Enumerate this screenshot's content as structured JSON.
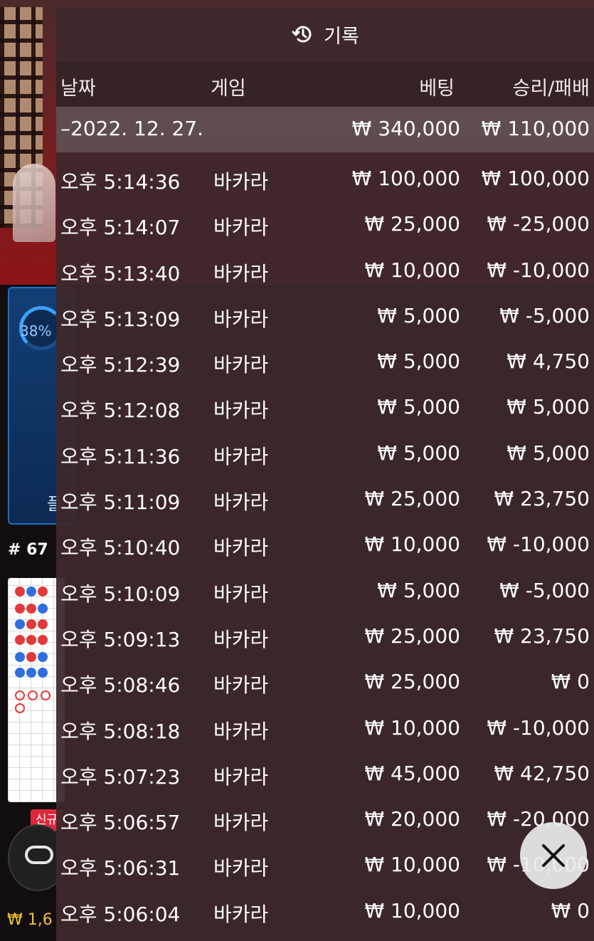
{
  "panel": {
    "title": "기록",
    "header_icon": "history-icon",
    "columns": {
      "date": "날짜",
      "game": "게임",
      "bet": "베팅",
      "win_loss": "승리/패배"
    },
    "summary": {
      "date": "–2022. 12. 27.",
      "bet": "₩ 340,000",
      "win_loss": "₩ 110,000"
    },
    "rows": [
      {
        "time": "오후 5:14:36",
        "game": "바카라",
        "bet": "₩ 100,000",
        "win_loss": "₩ 100,000"
      },
      {
        "time": "오후 5:14:07",
        "game": "바카라",
        "bet": "₩ 25,000",
        "win_loss": "₩ -25,000"
      },
      {
        "time": "오후 5:13:40",
        "game": "바카라",
        "bet": "₩ 10,000",
        "win_loss": "₩ -10,000"
      },
      {
        "time": "오후 5:13:09",
        "game": "바카라",
        "bet": "₩ 5,000",
        "win_loss": "₩ -5,000"
      },
      {
        "time": "오후 5:12:39",
        "game": "바카라",
        "bet": "₩ 5,000",
        "win_loss": "₩ 4,750"
      },
      {
        "time": "오후 5:12:08",
        "game": "바카라",
        "bet": "₩ 5,000",
        "win_loss": "₩ 5,000"
      },
      {
        "time": "오후 5:11:36",
        "game": "바카라",
        "bet": "₩ 5,000",
        "win_loss": "₩ 5,000"
      },
      {
        "time": "오후 5:11:09",
        "game": "바카라",
        "bet": "₩ 25,000",
        "win_loss": "₩ 23,750"
      },
      {
        "time": "오후 5:10:40",
        "game": "바카라",
        "bet": "₩ 10,000",
        "win_loss": "₩ -10,000"
      },
      {
        "time": "오후 5:10:09",
        "game": "바카라",
        "bet": "₩ 5,000",
        "win_loss": "₩ -5,000"
      },
      {
        "time": "오후 5:09:13",
        "game": "바카라",
        "bet": "₩ 25,000",
        "win_loss": "₩ 23,750"
      },
      {
        "time": "오후 5:08:46",
        "game": "바카라",
        "bet": "₩ 25,000",
        "win_loss": "₩ 0"
      },
      {
        "time": "오후 5:08:18",
        "game": "바카라",
        "bet": "₩ 10,000",
        "win_loss": "₩ -10,000"
      },
      {
        "time": "오후 5:07:23",
        "game": "바카라",
        "bet": "₩ 45,000",
        "win_loss": "₩ 42,750"
      },
      {
        "time": "오후 5:06:57",
        "game": "바카라",
        "bet": "₩ 20,000",
        "win_loss": "₩ -20,000"
      },
      {
        "time": "오후 5:06:31",
        "game": "바카라",
        "bet": "₩ 10,000",
        "win_loss": "₩ -10,000"
      },
      {
        "time": "오후 5:06:04",
        "game": "바카라",
        "bet": "₩ 10,000",
        "win_loss": "₩ 0"
      }
    ],
    "close_icon": "close-icon"
  },
  "background": {
    "stat_percent": "38%",
    "round_number": "# 67",
    "new_badge": "신규",
    "balance": "₩ 1,6",
    "colors": {
      "panel": "#3e282c",
      "banker": "#e23a3a",
      "player": "#2f6fe0",
      "balance": "#f2c22e"
    }
  }
}
